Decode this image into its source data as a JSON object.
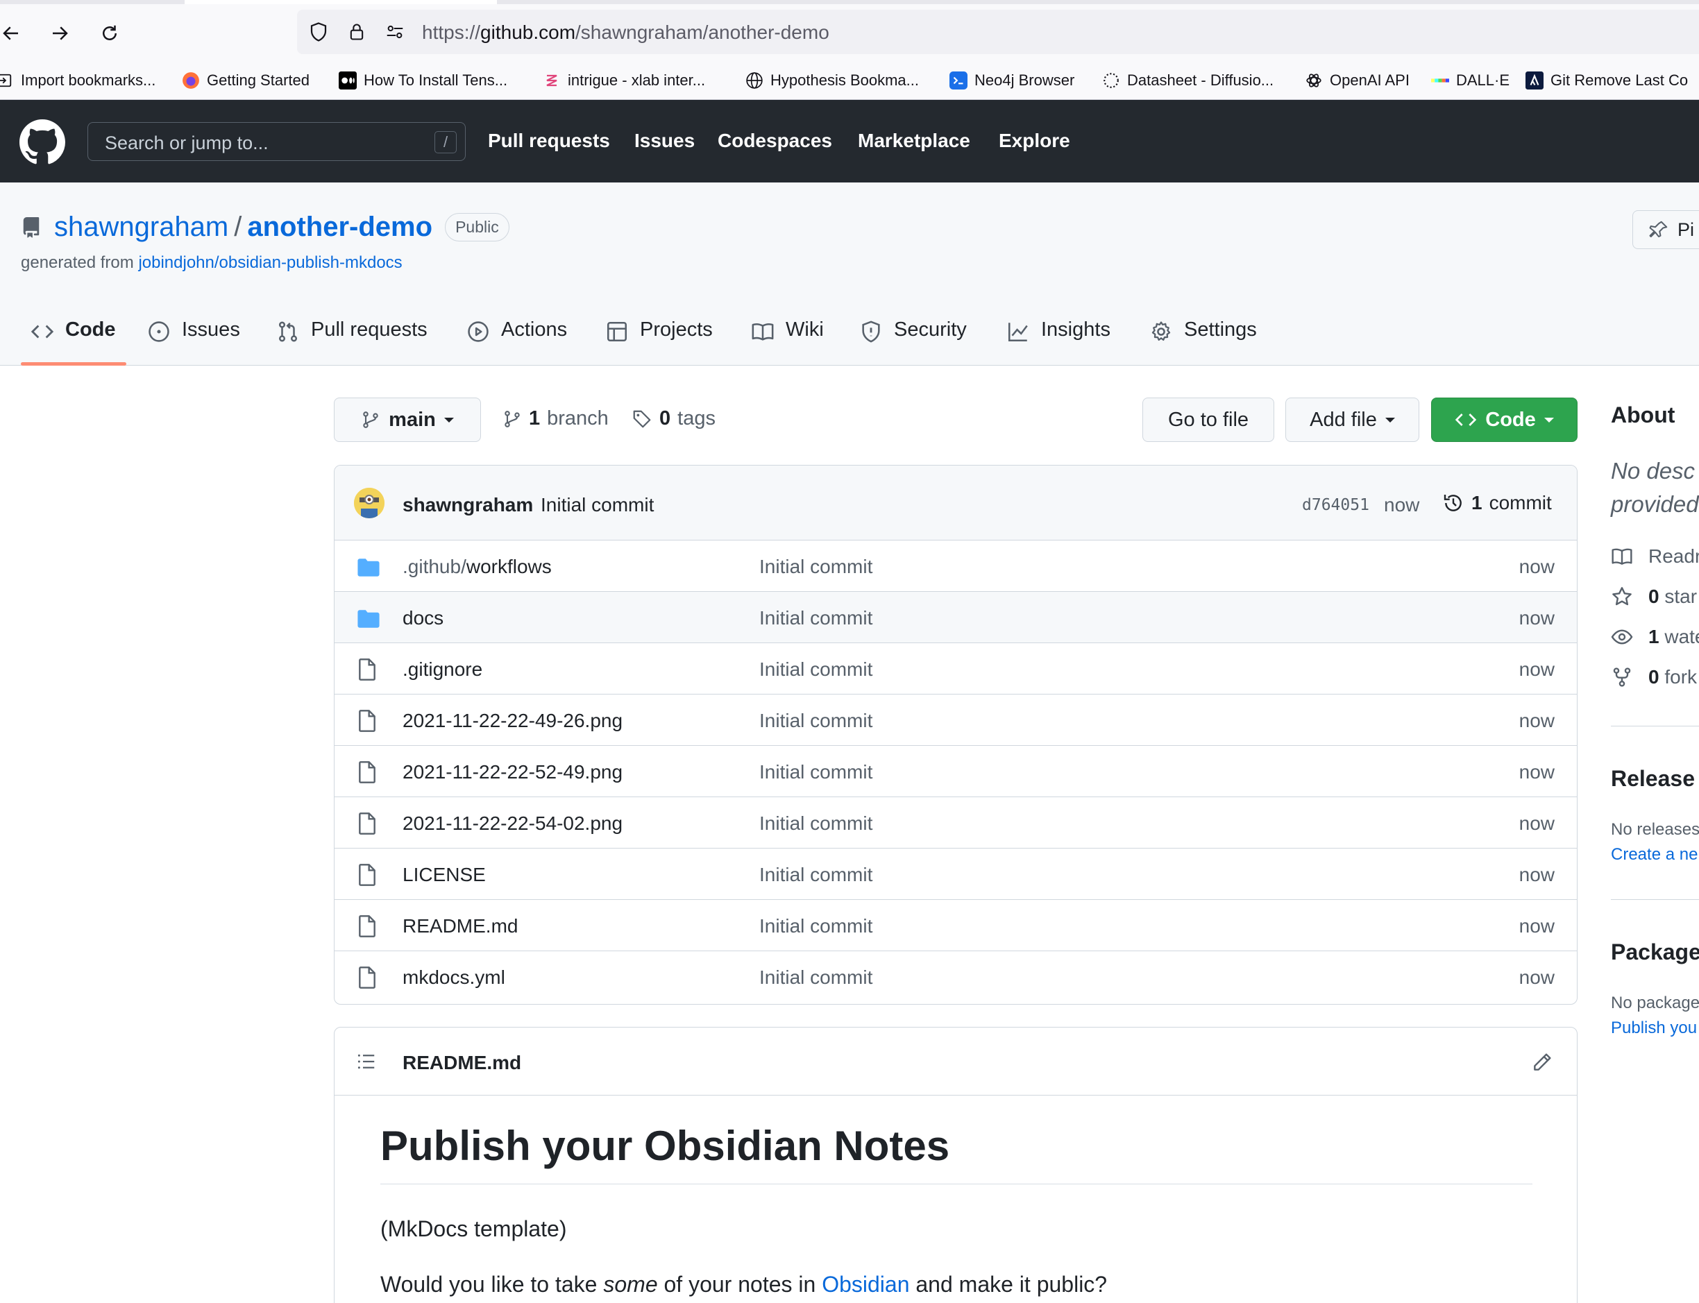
{
  "browser": {
    "url_prefix": "https://",
    "url_host": "github.com",
    "url_path": "/shawngraham/another-demo",
    "bookmarks": [
      {
        "label": "Import bookmarks...",
        "icon": "import-icon"
      },
      {
        "label": "Getting Started",
        "icon": "firefox-icon"
      },
      {
        "label": "How To Install Tens...",
        "icon": "medium-icon"
      },
      {
        "label": "intrigue - xlab inter...",
        "icon": "intrigue-icon"
      },
      {
        "label": "Hypothesis Bookma...",
        "icon": "globe-icon"
      },
      {
        "label": "Neo4j Browser",
        "icon": "terminal-icon"
      },
      {
        "label": "Datasheet - Diffusio...",
        "icon": "dotted-circle-icon"
      },
      {
        "label": "OpenAI API",
        "icon": "openai-icon"
      },
      {
        "label": "DALL·E",
        "icon": "dalle-icon"
      },
      {
        "label": "Git Remove Last Co",
        "icon": "lambda-icon"
      }
    ]
  },
  "gh": {
    "search_placeholder": "Search or jump to...",
    "search_shortcut": "/",
    "nav": [
      "Pull requests",
      "Issues",
      "Codespaces",
      "Marketplace",
      "Explore"
    ]
  },
  "repo": {
    "owner": "shawngraham",
    "separator": "/",
    "name": "another-demo",
    "visibility": "Public",
    "generated_prefix": "generated from",
    "generated_link": "jobindjohn/obsidian-publish-mkdocs",
    "pin_label": "Pi",
    "tabs": [
      "Code",
      "Issues",
      "Pull requests",
      "Actions",
      "Projects",
      "Wiki",
      "Security",
      "Insights",
      "Settings"
    ]
  },
  "toolbar": {
    "branch": "main",
    "branch_count": "1",
    "branch_label": "branch",
    "tag_count": "0",
    "tag_label": "tags",
    "go_to_file": "Go to file",
    "add_file": "Add file",
    "code": "Code"
  },
  "commit": {
    "author": "shawngraham",
    "message": "Initial commit",
    "sha": "d764051",
    "time": "now",
    "count": "1",
    "count_label": "commit"
  },
  "files": [
    {
      "dir_part": ".github/",
      "name": "workflows",
      "type": "folder",
      "commit": "Initial commit",
      "time": "now"
    },
    {
      "dir_part": "",
      "name": "docs",
      "type": "folder",
      "commit": "Initial commit",
      "time": "now"
    },
    {
      "dir_part": "",
      "name": ".gitignore",
      "type": "file",
      "commit": "Initial commit",
      "time": "now"
    },
    {
      "dir_part": "",
      "name": "2021-11-22-22-49-26.png",
      "type": "file",
      "commit": "Initial commit",
      "time": "now"
    },
    {
      "dir_part": "",
      "name": "2021-11-22-22-52-49.png",
      "type": "file",
      "commit": "Initial commit",
      "time": "now"
    },
    {
      "dir_part": "",
      "name": "2021-11-22-22-54-02.png",
      "type": "file",
      "commit": "Initial commit",
      "time": "now"
    },
    {
      "dir_part": "",
      "name": "LICENSE",
      "type": "file",
      "commit": "Initial commit",
      "time": "now"
    },
    {
      "dir_part": "",
      "name": "README.md",
      "type": "file",
      "commit": "Initial commit",
      "time": "now"
    },
    {
      "dir_part": "",
      "name": "mkdocs.yml",
      "type": "file",
      "commit": "Initial commit",
      "time": "now"
    }
  ],
  "readme": {
    "filename": "README.md",
    "h1": "Publish your Obsidian Notes",
    "p1": "(MkDocs template)",
    "p2_a": "Would you like to take ",
    "p2_em": "some",
    "p2_b": " of your notes in ",
    "p2_link": "Obsidian",
    "p2_c": " and make it public?"
  },
  "about": {
    "title": "About",
    "desc_line1": "No desc",
    "desc_line2": "provided",
    "readme": "Readr",
    "stars_count": "0",
    "stars_label": "star",
    "watch_count": "1",
    "watch_label": "wate",
    "forks_count": "0",
    "forks_label": "fork",
    "releases_title": "Release",
    "releases_text": "No releases",
    "releases_link": "Create a ne",
    "packages_title": "Package",
    "packages_text": "No package",
    "packages_link": "Publish you"
  },
  "colors": {
    "accent": "#0969da",
    "header_bg": "#24292f",
    "green_button": "#2da44e",
    "tab_underline": "#fd8c73",
    "folder": "#54aeff"
  }
}
